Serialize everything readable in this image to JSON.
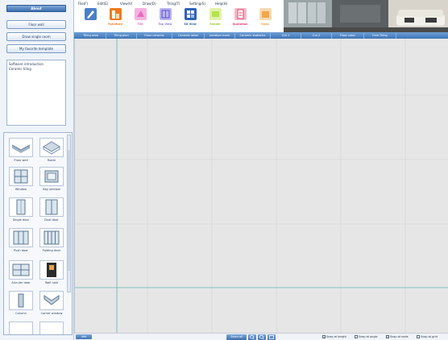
{
  "left_panel": {
    "about_label": "About",
    "buttons": [
      "Floor wall",
      "Draw single room",
      "My favorite template"
    ],
    "intro_list": [
      "Software introduction",
      "Ceramic tiling"
    ],
    "palette": [
      {
        "label": "Floor wall",
        "icon": "floor-wall-icon"
      },
      {
        "label": "Room",
        "icon": "room-icon"
      },
      {
        "label": "Window",
        "icon": "window-icon"
      },
      {
        "label": "Bay window",
        "icon": "bay-window-icon"
      },
      {
        "label": "Single door",
        "icon": "single-door-icon"
      },
      {
        "label": "Dual door",
        "icon": "dual-door-icon"
      },
      {
        "label": "Push door",
        "icon": "push-door-icon"
      },
      {
        "label": "Folding door",
        "icon": "folding-door-icon"
      },
      {
        "label": "Annular door",
        "icon": "annular-door-icon"
      },
      {
        "label": "Wall hole",
        "icon": "wall-hole-icon"
      },
      {
        "label": "Column",
        "icon": "column-icon"
      },
      {
        "label": "Corner window",
        "icon": "corner-window-icon"
      }
    ]
  },
  "menu": [
    "File(F)",
    "Edit(E)",
    "View(V)",
    "Draw(D)",
    "Tiling(T)",
    "Setting(S)",
    "Help(H)"
  ],
  "toolbar": [
    {
      "label": "",
      "color": "#4a7fc8",
      "label_color": "#4a7fc8"
    },
    {
      "label": "Furniture",
      "color": "#f07a1e",
      "label_color": "#f07a1e"
    },
    {
      "label": "Tile",
      "color": "#e86bc2",
      "label_color": "#e86bc2"
    },
    {
      "label": "Top View",
      "color": "#8a7fe0",
      "label_color": "#8a7fe0"
    },
    {
      "label": "3D View",
      "color": "#2f62b5",
      "label_color": "#2f62b5"
    },
    {
      "label": "Render",
      "color": "#b6e24a",
      "label_color": "#9ccc3a"
    },
    {
      "label": "Quotation",
      "color": "#e0446d",
      "label_color": "#e0446d"
    },
    {
      "label": "Stats",
      "color": "#f2a64a",
      "label_color": "#f2a64a"
    }
  ],
  "tabs": [
    "Tiling area",
    "Tiling plan",
    "Floor ceramic",
    "Ceramic label",
    "Location mark",
    "Ceramic statistics",
    "Cut 1",
    "Cut 2",
    "Floor color",
    "Free Tiling"
  ],
  "status": {
    "more_label": "Info",
    "zoom_all_label": "Zoom all",
    "snaps": [
      {
        "label": "Snap at length",
        "checked": true
      },
      {
        "label": "Snap at angle",
        "checked": false
      },
      {
        "label": "Snap at node",
        "checked": true
      },
      {
        "label": "Snap at grid",
        "checked": false
      }
    ]
  },
  "colors": {
    "accent": "#3e6fb0",
    "tab_bar": "#4f85c6",
    "canvas": "#e6e6e6",
    "guide_line": "#5fb7b0",
    "grid_line": "#d3d3d3"
  }
}
